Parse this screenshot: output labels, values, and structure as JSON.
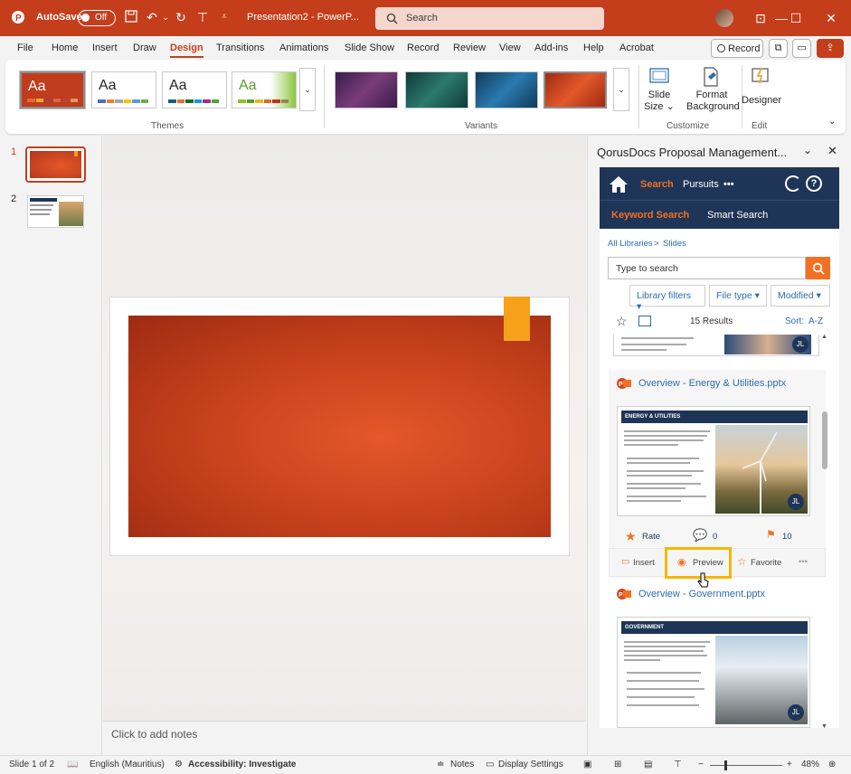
{
  "titlebar": {
    "autosave_label": "AutoSave",
    "autosave_state": "Off",
    "document_title": "Presentation2 - PowerP...",
    "search_placeholder": "Search"
  },
  "menu": {
    "tabs": [
      "File",
      "Home",
      "Insert",
      "Draw",
      "Design",
      "Transitions",
      "Animations",
      "Slide Show",
      "Record",
      "Review",
      "View",
      "Add-ins",
      "Help",
      "Acrobat"
    ],
    "active": "Design",
    "record_button": "Record"
  },
  "ribbon": {
    "themes_label": "Themes",
    "variants_label": "Variants",
    "customize_label": "Customize",
    "edit_label": "Edit",
    "theme_sample": "Aa",
    "slide_size_1": "Slide",
    "slide_size_2": "Size",
    "format_bg_1": "Format",
    "format_bg_2": "Background",
    "designer": "Designer"
  },
  "thumbnails": {
    "slide_numbers": [
      "1",
      "2"
    ]
  },
  "canvas": {
    "notes_placeholder": "Click to add notes"
  },
  "pane": {
    "title": "QorusDocs Proposal Management...",
    "nav": {
      "search": "Search",
      "pursuits": "Pursuits",
      "more": "•••",
      "keyword_search": "Keyword Search",
      "smart_search": "Smart Search"
    },
    "breadcrumb": {
      "root": "All Libraries",
      "sep": ">",
      "current": "Slides"
    },
    "search_placeholder": "Type to search",
    "filters": [
      "Library filters",
      "File type",
      "Modified"
    ],
    "results_count": "15 Results",
    "sort_label": "Sort:",
    "sort_value": "A-Z",
    "results": [
      {
        "title": "Overview - Energy & Utilities.pptx",
        "thumb_heading": "ENERGY & UTILITIES",
        "avatar": "JL",
        "rate": "Rate",
        "comments": "0",
        "uses": "10"
      },
      {
        "title": "Overview - Government.pptx",
        "thumb_heading": "GOVERNMENT",
        "avatar": "JL"
      }
    ],
    "actions": {
      "insert": "Insert",
      "preview": "Preview",
      "favorite": "Favorite",
      "more": "•••"
    },
    "prev_avatar": "JL"
  },
  "status": {
    "slide_info": "Slide 1 of 2",
    "language": "English (Mauritius)",
    "accessibility": "Accessibility: Investigate",
    "notes": "Notes",
    "display_settings": "Display Settings",
    "zoom": "48%"
  },
  "colors": {
    "accent": "#c43e1c",
    "qorus_navy": "#1e3557",
    "qorus_orange": "#f37021",
    "highlight": "#f5b700"
  }
}
